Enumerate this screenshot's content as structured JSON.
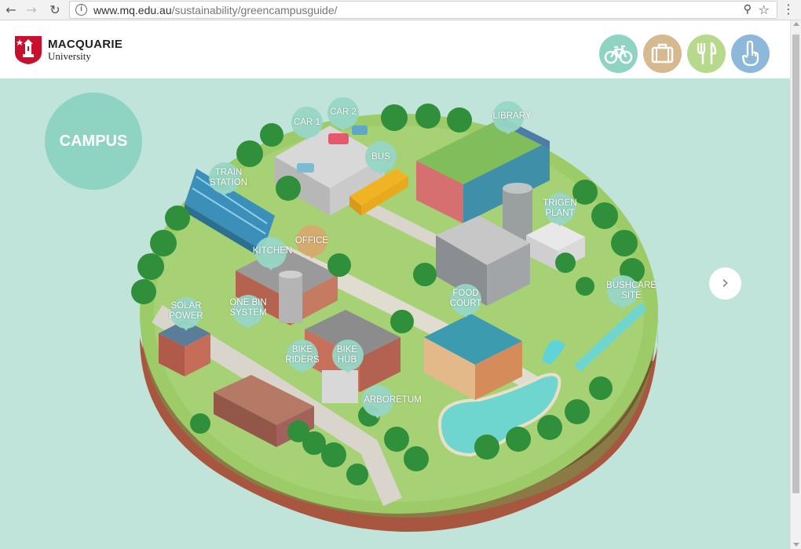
{
  "browser": {
    "back_icon": "arrow-left-icon",
    "forward_icon": "arrow-right-icon",
    "reload_icon": "reload-icon",
    "url_host": "www.mq.edu.au",
    "url_path": "/sustainability/greencampusguide/",
    "zoom_icon": "zoom-icon",
    "bookmark_icon": "star-icon",
    "menu_icon": "vertical-dots-icon"
  },
  "header": {
    "brand_line1": "MACQUARIE",
    "brand_line2": "University",
    "topics": [
      {
        "icon": "bicycle-icon",
        "color": "#8fd3c3"
      },
      {
        "icon": "briefcase-icon",
        "color": "#d7b98f"
      },
      {
        "icon": "cutlery-icon",
        "color": "#b7d98b"
      },
      {
        "icon": "hand-pointing-icon",
        "color": "#8db8db"
      }
    ]
  },
  "main": {
    "section_title": "CAMPUS",
    "next_icon": "chevron-right-icon",
    "locations": {
      "car1": "CAR 1",
      "car2": "CAR 2",
      "library": "LIBRARY",
      "bus": "BUS",
      "train_station": "TRAIN\nSTATION",
      "trigen_plant": "TRIGEN\nPLANT",
      "office": "OFFICE",
      "kitchen": "KITCHEN",
      "food_court": "FOOD\nCOURT",
      "bushcare_site": "BUSHCARE\nSITE",
      "solar_power": "SOLAR\nPOWER",
      "one_bin_system": "ONE BIN\nSYSTEM",
      "bike_riders": "BIKE\nRIDERS",
      "bike_hub": "BIKE\nHUB",
      "arboretum": "ARBORETUM"
    }
  },
  "colors": {
    "background": "#c0e3da",
    "badge": "#8fd3c3",
    "pin": "#97d6c5",
    "pin_office": "#d5aa6e",
    "grass": "#9ccb68",
    "soil": "#a8563f",
    "brand_red": "#c8102e"
  }
}
